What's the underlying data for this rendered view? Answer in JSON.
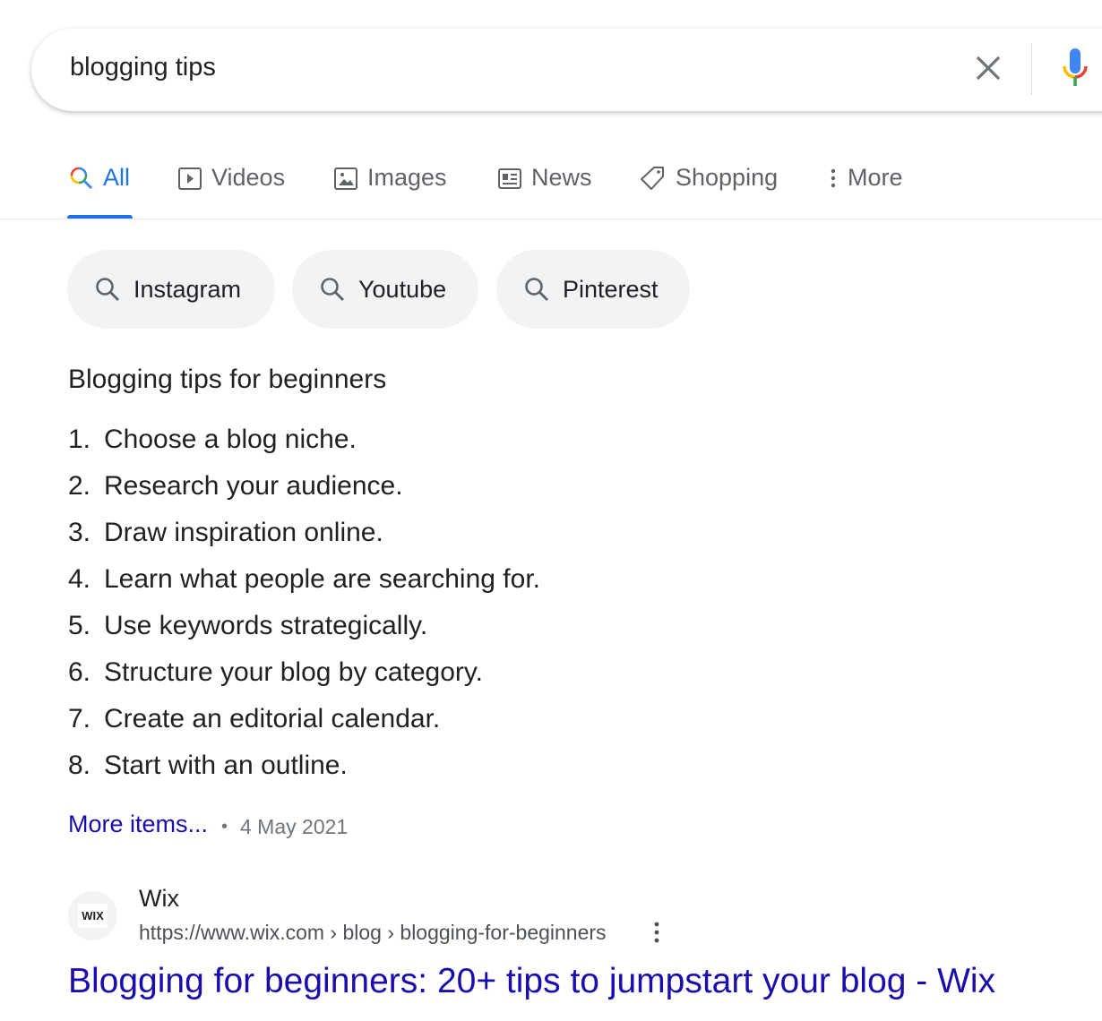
{
  "search": {
    "query": "blogging tips"
  },
  "tabs": [
    {
      "label": "All",
      "icon": "search-icon",
      "active": true
    },
    {
      "label": "Videos",
      "icon": "video-icon"
    },
    {
      "label": "Images",
      "icon": "image-icon"
    },
    {
      "label": "News",
      "icon": "news-icon"
    },
    {
      "label": "Shopping",
      "icon": "tag-icon"
    },
    {
      "label": "More",
      "icon": "more-vert-icon"
    }
  ],
  "chips": [
    {
      "label": "Instagram"
    },
    {
      "label": "Youtube"
    },
    {
      "label": "Pinterest"
    }
  ],
  "snippet": {
    "heading": "Blogging tips for beginners",
    "items": [
      {
        "n": "1.",
        "text": "Choose a blog niche."
      },
      {
        "n": "2.",
        "text": "Research your audience."
      },
      {
        "n": "3.",
        "text": "Draw inspiration online."
      },
      {
        "n": "4.",
        "text": "Learn what people are searching for."
      },
      {
        "n": "5.",
        "text": "Use keywords strategically."
      },
      {
        "n": "6.",
        "text": "Structure your blog by category."
      },
      {
        "n": "7.",
        "text": "Create an editorial calendar."
      },
      {
        "n": "8.",
        "text": "Start with an outline."
      }
    ],
    "more_label": "More items...",
    "separator": "•",
    "date": "4 May 2021"
  },
  "result": {
    "favicon_text": "WIX",
    "site": "Wix",
    "url": "https://www.wix.com › blog › blogging-for-beginners",
    "title": "Blogging for beginners: 20+ tips to jumpstart your blog - Wix"
  },
  "colors": {
    "accent": "#1a73e8",
    "link": "#1a0dab",
    "chip_bg": "#f1f3f4"
  }
}
